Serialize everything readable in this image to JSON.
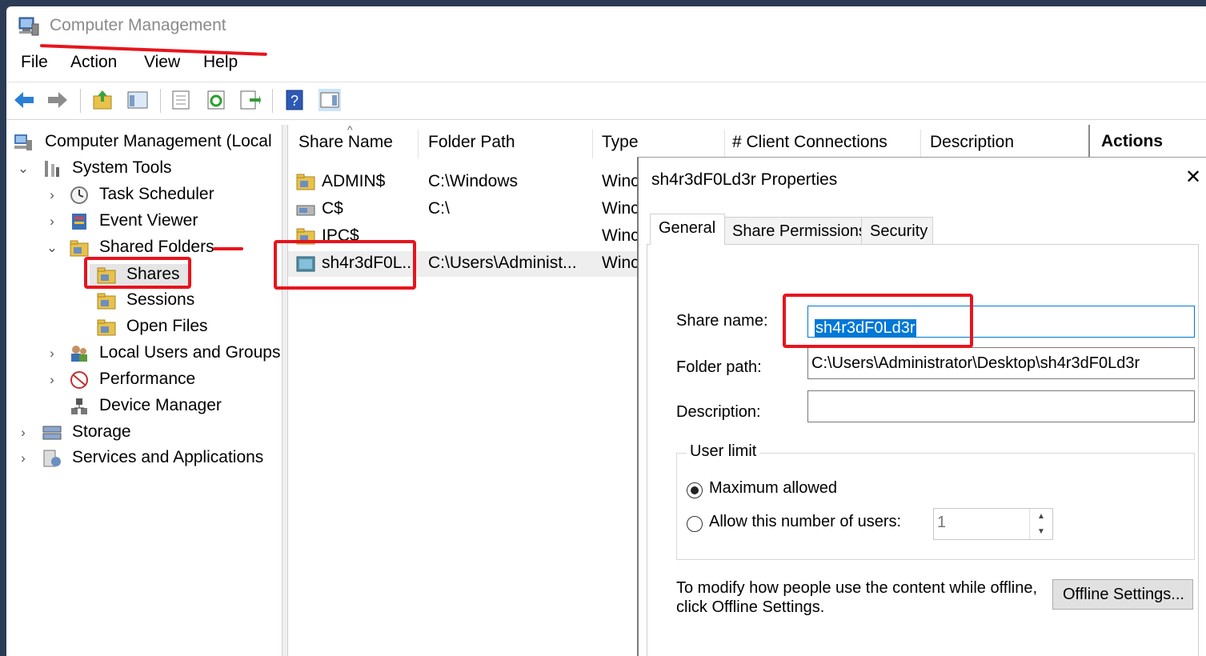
{
  "window": {
    "title": "Computer Management"
  },
  "menu": [
    "File",
    "Action",
    "View",
    "Help"
  ],
  "tree": {
    "root": "Computer Management (Local",
    "system_tools": "System Tools",
    "task_scheduler": "Task Scheduler",
    "event_viewer": "Event Viewer",
    "shared_folders": "Shared Folders",
    "shares": "Shares",
    "sessions": "Sessions",
    "open_files": "Open Files",
    "local_users": "Local Users and Groups",
    "performance": "Performance",
    "device_manager": "Device Manager",
    "storage": "Storage",
    "services": "Services and Applications"
  },
  "list": {
    "columns": [
      "Share Name",
      "Folder Path",
      "Type",
      "# Client Connections",
      "Description"
    ],
    "rows": [
      {
        "name": "ADMIN$",
        "path": "C:\\Windows",
        "type": "Winc"
      },
      {
        "name": "C$",
        "path": "C:\\",
        "type": "Winc"
      },
      {
        "name": "IPC$",
        "path": "",
        "type": "Winc"
      },
      {
        "name": "sh4r3dF0L...",
        "path": "C:\\Users\\Administ...",
        "type": "Winc"
      }
    ]
  },
  "actions": {
    "title": "Actions"
  },
  "dialog": {
    "title": "sh4r3dF0Ld3r Properties",
    "close": "✕",
    "tabs": [
      "General",
      "Share Permissions",
      "Security"
    ],
    "share_name_label": "Share name:",
    "share_name_value": "sh4r3dF0Ld3r",
    "folder_path_label": "Folder path:",
    "folder_path_value": "C:\\Users\\Administrator\\Desktop\\sh4r3dF0Ld3r",
    "description_label": "Description:",
    "description_value": "",
    "user_limit_label": "User limit",
    "maximum_allowed": "Maximum allowed",
    "allow_number": "Allow this number of users:",
    "user_count": "1",
    "offline_text_1": "To modify how people use the content while offline,",
    "offline_text_2": "click Offline Settings.",
    "offline_button": "Offline Settings..."
  },
  "colors": {
    "annotation": "#e8141c",
    "selection": "#0078d7"
  }
}
